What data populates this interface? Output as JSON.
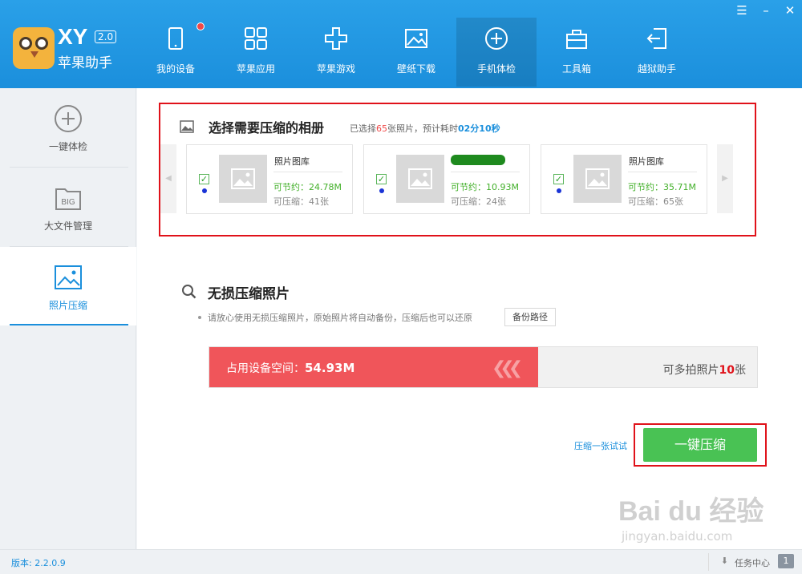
{
  "app": {
    "logo_text": "XY",
    "version_badge": "2.0",
    "name": "苹果助手",
    "brand_color": "#1b8fdc"
  },
  "window_controls": [
    "menu-icon",
    "minimize-icon",
    "close-icon"
  ],
  "nav": [
    {
      "label": "我的设备",
      "icon": "device-icon",
      "badge": true
    },
    {
      "label": "苹果应用",
      "icon": "apps-grid-icon"
    },
    {
      "label": "苹果游戏",
      "icon": "gamepad-icon"
    },
    {
      "label": "壁纸下载",
      "icon": "image-icon"
    },
    {
      "label": "手机体检",
      "icon": "plus-circle-icon",
      "active": true
    },
    {
      "label": "工具箱",
      "icon": "toolbox-icon"
    },
    {
      "label": "越狱助手",
      "icon": "exit-icon"
    }
  ],
  "sidebar": [
    {
      "label": "一键体检",
      "icon": "plus-circle-icon"
    },
    {
      "label": "大文件管理",
      "icon": "big-file-icon",
      "icon_text": "BIG"
    },
    {
      "label": "照片压缩",
      "icon": "photo-icon",
      "active": true
    }
  ],
  "album_section": {
    "title": "选择需要压缩的相册",
    "info_prefix": "已选择",
    "selected_count": "65",
    "info_middle": "张照片，预计耗时",
    "estimated_time": "02分10秒",
    "albums": [
      {
        "name": "照片图库",
        "save": "可节约：24.78M",
        "compressible": "可压缩：41张",
        "checked": true
      },
      {
        "name": "",
        "save": "可节约：10.93M",
        "compressible": "可压缩：24张",
        "checked": true,
        "name_redacted": true
      },
      {
        "name": "照片图库",
        "save": "可节约：35.71M",
        "compressible": "可压缩：65张",
        "checked": true
      }
    ]
  },
  "lossless": {
    "title": "无损压缩照片",
    "hint": "请放心使用无损压缩照片，原始照片将自动备份，压缩后也可以还原",
    "backup_button": "备份路径"
  },
  "usage_bar": {
    "label_prefix": "占用设备空间：",
    "used": "54.93M",
    "fill_fraction": 0.6,
    "right_prefix": "可多拍照片",
    "extra_photos": "10",
    "right_suffix": "张"
  },
  "actions": {
    "try_one": "压缩一张试试",
    "compress_all": "一键压缩"
  },
  "watermark": {
    "main": "Bai du 经验",
    "sub": "jingyan.baidu.com"
  },
  "status": {
    "version": "版本: 2.2.0.9",
    "task_center": "任务中心",
    "task_count": "1"
  }
}
